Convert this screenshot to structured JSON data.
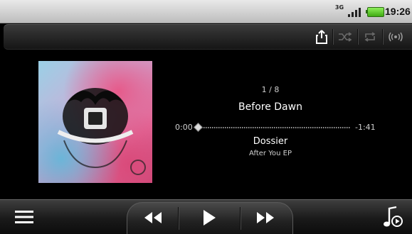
{
  "status_bar": {
    "network_type": "3G",
    "time": "19:26",
    "battery_color": "#4cc41e"
  },
  "toolbar": {
    "icons": [
      "share-icon",
      "shuffle-icon",
      "repeat-icon",
      "wireless-icon"
    ]
  },
  "player": {
    "track_counter": "1 / 8",
    "song_title": "Before Dawn",
    "elapsed": "0:00",
    "remaining": "-1:41",
    "progress": 0,
    "artist": "Dossier",
    "album": "After You EP"
  },
  "controls": {
    "icons": [
      "menu-icon",
      "previous-icon",
      "play-icon",
      "next-icon",
      "music-library-icon"
    ]
  }
}
